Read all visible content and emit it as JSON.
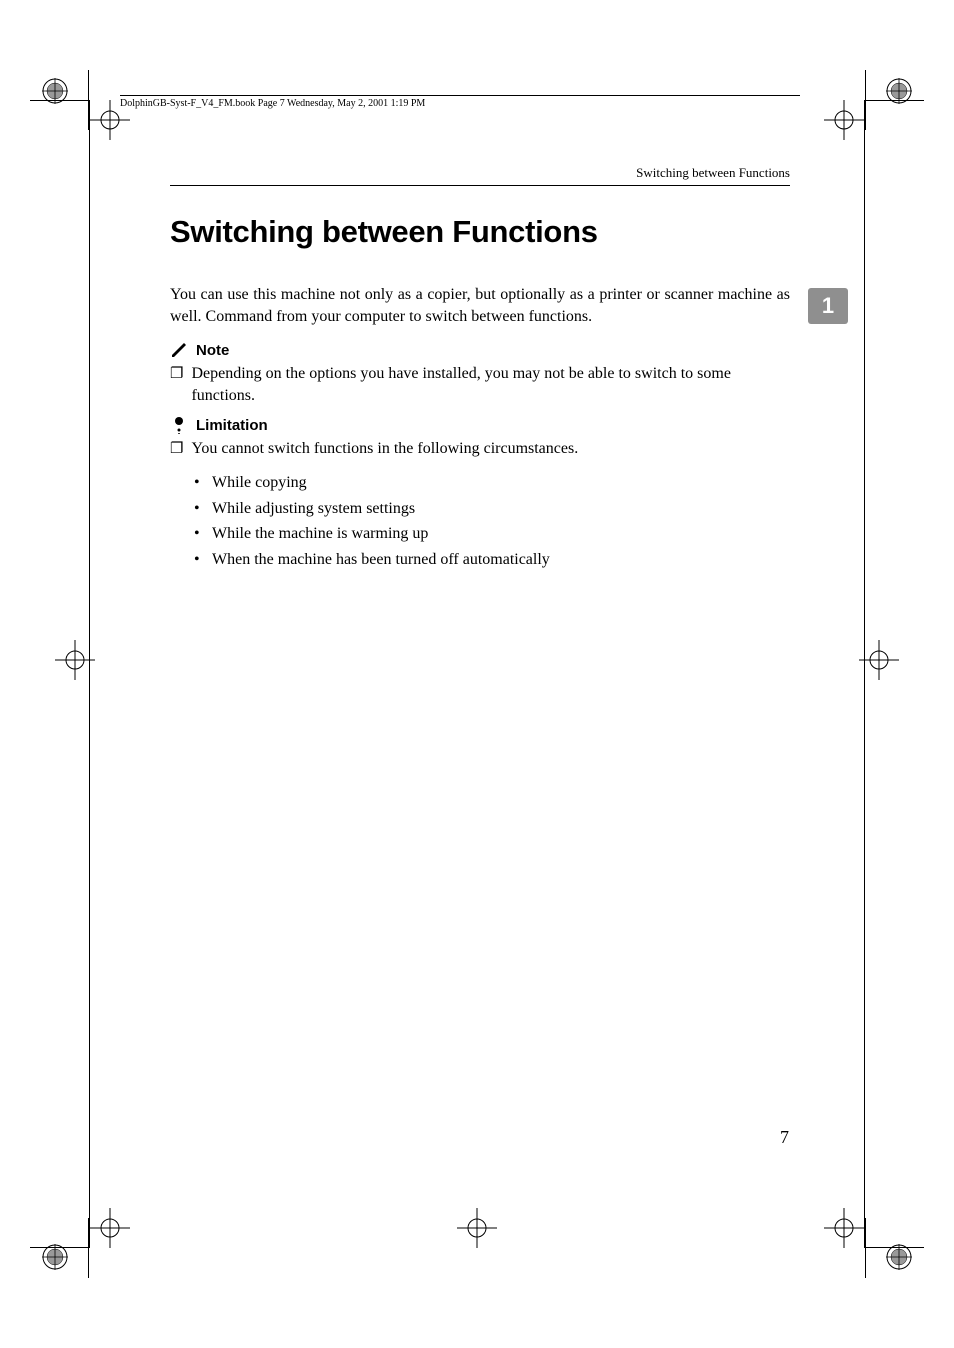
{
  "book_info": "DolphinGB-Syst-F_V4_FM.book  Page 7  Wednesday, May 2, 2001  1:19 PM",
  "running_head": "Switching between Functions",
  "title": "Switching between Functions",
  "paragraph": "You can use this machine not only as a copier, but optionally as a printer or scanner machine as well. Command from your computer to switch between functions.",
  "note": {
    "label": "Note",
    "items": [
      "Depending on the options you have installed, you may not be able to switch to some functions."
    ]
  },
  "limitation": {
    "label": "Limitation",
    "intro": "You cannot switch functions in the following circumstances.",
    "bullets": [
      "While copying",
      "While adjusting system settings",
      "While the machine is warming up",
      "When the machine has been turned off automatically"
    ]
  },
  "side_tab": "1",
  "page_number": "7",
  "icons": {
    "note": "pencil-icon",
    "limitation": "person-icon"
  }
}
